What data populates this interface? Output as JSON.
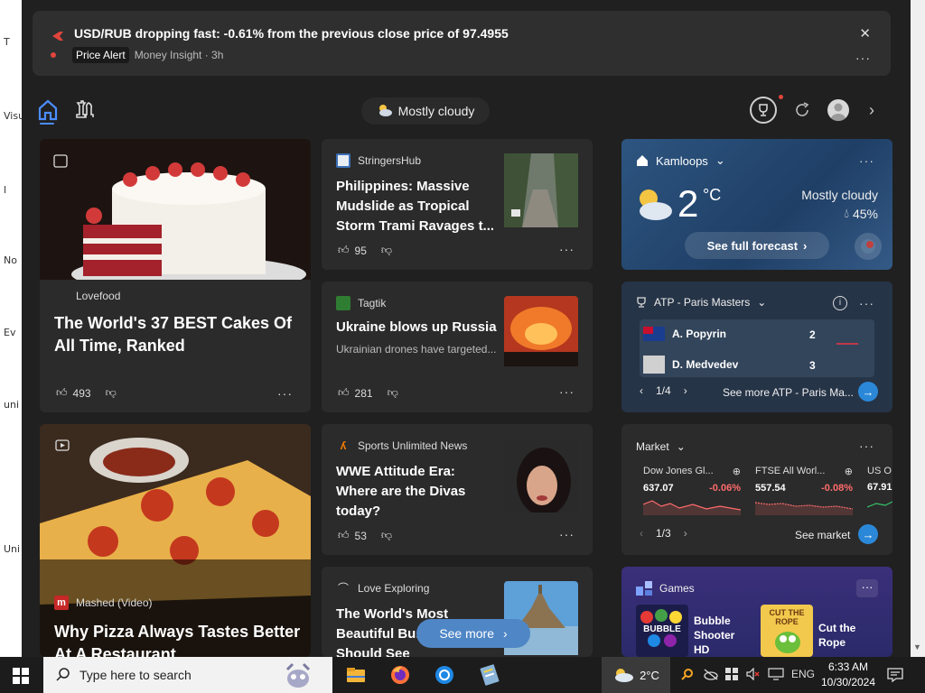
{
  "desktop_strip": [
    "T",
    "Visu",
    "l",
    "No",
    "Ev",
    "uni",
    "Uni"
  ],
  "alert": {
    "title": "USD/RUB dropping fast: -0.61% from the previous close price of 97.4955",
    "tag": "Price Alert",
    "source": "Money Insight · 3h",
    "close": "✕",
    "more": "···"
  },
  "topbar": {
    "weather": "Mostly cloudy",
    "next": "›"
  },
  "cards": {
    "cakes": {
      "source": "Lovefood",
      "title": "The World's 37 BEST Cakes Of All Time, Ranked",
      "likes": "493"
    },
    "philippines": {
      "source": "StringersHub",
      "title": "Philippines: Massive Mudslide as Tropical Storm Trami Ravages t...",
      "likes": "95"
    },
    "ukraine": {
      "source": "Tagtik",
      "title": "Ukraine blows up Russia",
      "snippet": "Ukrainian drones have targeted...",
      "likes": "281"
    },
    "pizza": {
      "source": "Mashed (Video)",
      "title": "Why Pizza Always Tastes Better At A Restaurant"
    },
    "wwe": {
      "source": "Sports Unlimited News",
      "title": "WWE Attitude Era: Where are the Divas today?",
      "likes": "53"
    },
    "travel": {
      "source": "Love Exploring",
      "title": "The World's Most Beautiful Bu... Everyone Should See"
    }
  },
  "weather_widget": {
    "location": "Kamloops",
    "temp": "2",
    "unit": "°C",
    "condition": "Mostly cloudy",
    "precip": "45%",
    "button": "See full forecast"
  },
  "sports_widget": {
    "title": "ATP - Paris Masters",
    "players": [
      {
        "name": "A. Popyrin",
        "score": "2"
      },
      {
        "name": "D. Medvedev",
        "score": "3"
      }
    ],
    "page": "1/4",
    "see_more": "See more ATP - Paris Ma..."
  },
  "market_widget": {
    "title": "Market",
    "tickers": [
      {
        "name": "Dow Jones Gl...",
        "value": "637.07",
        "change": "-0.06%"
      },
      {
        "name": "FTSE All Worl...",
        "value": "557.54",
        "change": "-0.08%"
      },
      {
        "name": "US O",
        "value": "67.91",
        "change": ""
      }
    ],
    "page": "1/3",
    "see_market": "See market"
  },
  "games_widget": {
    "title": "Games",
    "games": [
      {
        "name": "Bubble Shooter HD",
        "logo_text": "BUBBLE"
      },
      {
        "name": "Cut the Rope",
        "logo_text": "CUT THE ROPE"
      }
    ]
  },
  "see_more": "See more",
  "taskbar": {
    "search_placeholder": "Type here to search",
    "weather": "2°C",
    "lang": "ENG",
    "time": "6:33 AM",
    "date": "10/30/2024"
  },
  "colors": {
    "accent": "#2b88d8",
    "negative": "#ff6b6b",
    "alert": "#e0453b"
  }
}
